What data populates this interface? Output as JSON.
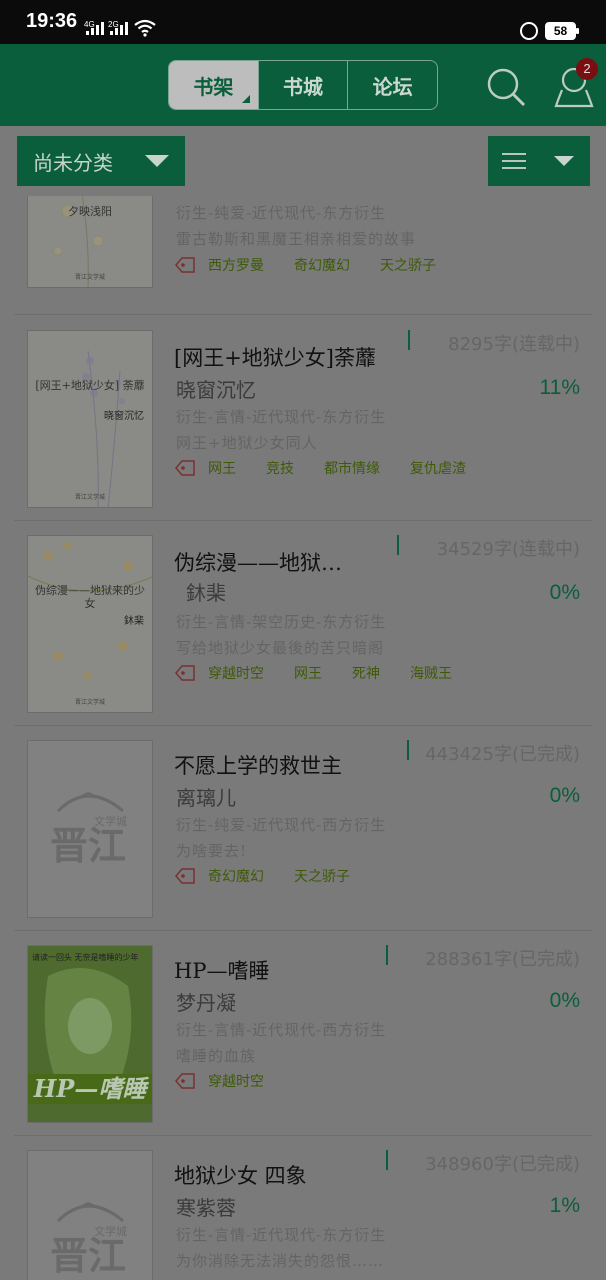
{
  "status_bar": {
    "time": "19:36",
    "net1": "4G",
    "net2": "2G",
    "battery": "58"
  },
  "header": {
    "tabs": [
      "书架",
      "书城",
      "论坛"
    ],
    "active_tab": 0,
    "badge_count": "2"
  },
  "toolbar": {
    "category_label": "尚未分类"
  },
  "books": [
    {
      "words": "",
      "title": "",
      "author": "",
      "progress": "",
      "genre": "衍生-纯爱-近代现代-东方衍生",
      "desc": "雷古勒斯和黑魔王相亲相爱的故事",
      "tags": [
        "西方罗曼",
        "奇幻魔幻",
        "天之骄子"
      ],
      "cover": {
        "style": "floral",
        "title": "夕映浅阳",
        "author": "",
        "publisher": "晋江文学城"
      }
    },
    {
      "words": "8295字(连载中)",
      "title": "[网王+地狱少女]荼蘼",
      "author": "晓窗沉忆",
      "progress": "11%",
      "genre": "衍生-言情-近代现代-东方衍生",
      "desc": "网王+地狱少女同人",
      "tags": [
        "网王",
        "竞技",
        "都市情缘",
        "复仇虐渣"
      ],
      "cover": {
        "style": "floral",
        "title": "[网王+地狱少女] 荼蘼",
        "author": "晓窗沉忆",
        "publisher": "晋江文学城"
      }
    },
    {
      "words": "34529字(连载中)",
      "title": "伪综漫——地狱…",
      "author": "鈢棐",
      "progress": "0%",
      "genre": "衍生-言情-架空历史-东方衍生",
      "desc": "写给地狱少女最後的苦只暗阁",
      "tags": [
        "穿越时空",
        "网王",
        "死神",
        "海贼王"
      ],
      "cover": {
        "style": "floral",
        "title": "伪综漫——地狱来的少女",
        "author": "鈢棐",
        "publisher": "晋江文学城"
      }
    },
    {
      "words": "443425字(已完成)",
      "title": "不愿上学的救世主",
      "author": "离璃儿",
      "progress": "0%",
      "genre": "衍生-纯爱-近代现代-西方衍生",
      "desc": "为啥要去!",
      "tags": [
        "奇幻魔幻",
        "天之骄子"
      ],
      "cover": {
        "style": "plain",
        "title": "晋江",
        "author": "",
        "publisher": "文学城"
      }
    },
    {
      "words": "288361字(已完成)",
      "title": "HP—嗜睡",
      "author": "梦丹凝",
      "progress": "0%",
      "genre": "衍生-言情-近代现代-西方衍生",
      "desc": "嗜睡的血族",
      "tags": [
        "穿越时空"
      ],
      "cover": {
        "style": "hp",
        "title": "HP—嗜睡",
        "author": "",
        "publisher": "请读一回头 无奈是嗜睡的少年"
      }
    },
    {
      "words": "348960字(已完成)",
      "title": "地狱少女 四象",
      "author": "寒紫蓉",
      "progress": "1%",
      "genre": "衍生-言情-近代现代-东方衍生",
      "desc": "为你消除无法消失的怨恨……",
      "tags": [],
      "cover": {
        "style": "plain",
        "title": "晋江",
        "author": "",
        "publisher": "文学城"
      }
    }
  ]
}
